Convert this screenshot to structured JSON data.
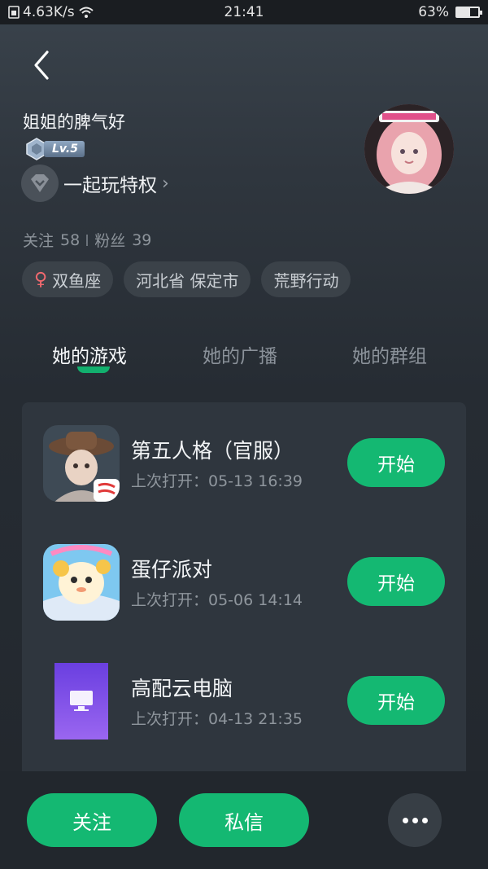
{
  "status_bar": {
    "speed": "4.63K/s",
    "time": "21:41",
    "battery": "63%",
    "battery_level": 0.63
  },
  "profile": {
    "nickname": "姐姐的脾气好",
    "level": "Lv.5",
    "privilege": "一起玩特权",
    "stats": {
      "follow_label": "关注",
      "follow_count": "58",
      "fans_label": "粉丝",
      "fans_count": "39"
    },
    "tags": [
      "双鱼座",
      "河北省 保定市",
      "荒野行动"
    ]
  },
  "tabs": [
    "她的游戏",
    "她的广播",
    "她的群组"
  ],
  "active_tab": 0,
  "games": [
    {
      "name": "第五人格（官服）",
      "last_open": "上次打开：05-13 16:39",
      "button": "开始",
      "icon": "identity-v-icon"
    },
    {
      "name": "蛋仔派对",
      "last_open": "上次打开：05-06 14:14",
      "button": "开始",
      "icon": "eggy-party-icon"
    },
    {
      "name": "高配云电脑",
      "last_open": "上次打开：04-13 21:35",
      "button": "开始",
      "icon": "cloud-pc-icon"
    }
  ],
  "bottom": {
    "follow": "关注",
    "message": "私信",
    "more_icon": "more-icon"
  },
  "colors": {
    "accent": "#14b872",
    "female": "#f0696f"
  }
}
